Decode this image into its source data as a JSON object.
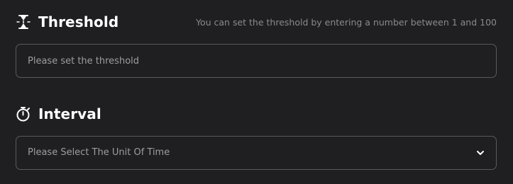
{
  "threshold": {
    "title": "Threshold",
    "icon": "hourglass-icon",
    "hint": "You can set the threshold by entering a number between 1 and 100",
    "placeholder": "Please set the threshold",
    "value": ""
  },
  "interval": {
    "title": "Interval",
    "icon": "stopwatch-icon",
    "select_placeholder": "Please Select The Unit Of Time",
    "dropdown_icon": "chevron-down-icon"
  },
  "colors": {
    "background": "#1f1f21",
    "border": "#5a5a5c",
    "text": "#ffffff",
    "muted": "#9d9d9f"
  }
}
